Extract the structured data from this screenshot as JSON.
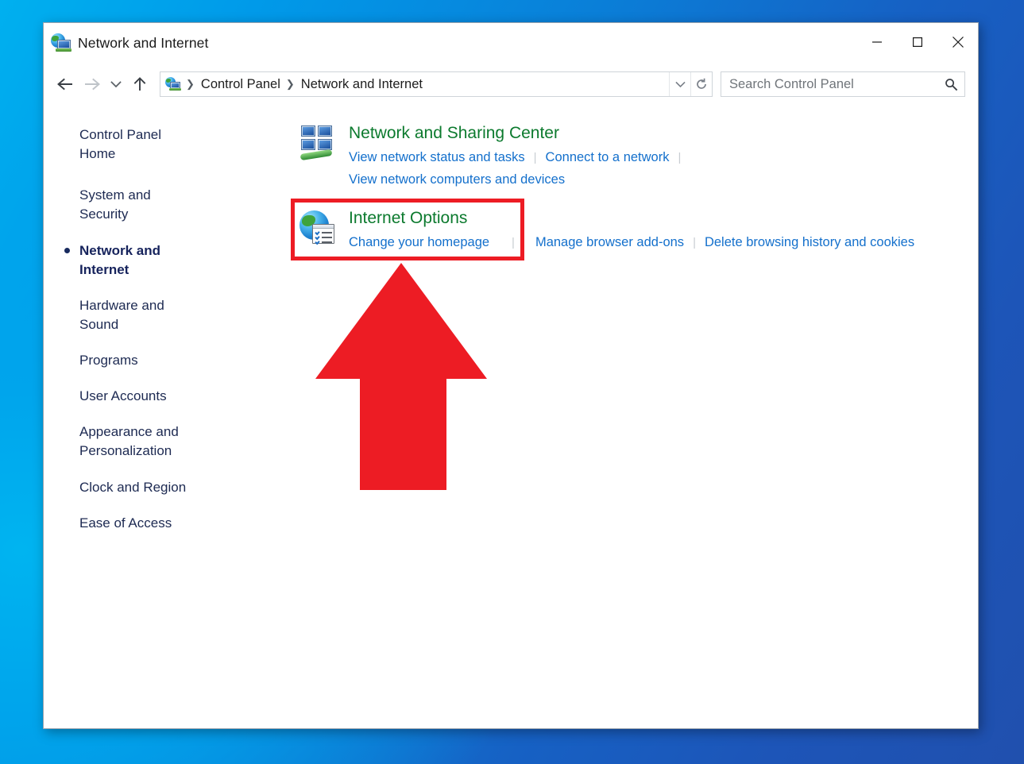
{
  "window": {
    "title": "Network and Internet",
    "icon": "network-globe-icon",
    "controls": {
      "minimize": "minimize-button",
      "maximize": "maximize-button",
      "close": "close-button"
    }
  },
  "toolbar": {
    "back": "back-arrow-icon",
    "forward": "forward-arrow-icon",
    "recent": "recent-locations-chevron-icon",
    "up": "up-arrow-icon",
    "address_icon": "network-globe-icon",
    "breadcrumbs": [
      "Control Panel",
      "Network and Internet"
    ],
    "breadcrumb_separator": "❯",
    "dropdown": "chevron-down-icon",
    "refresh": "refresh-icon"
  },
  "search": {
    "placeholder": "Search Control Panel",
    "value": "",
    "icon": "search-icon"
  },
  "sidebar": {
    "items": [
      {
        "label": "Control Panel Home",
        "current": false,
        "gap": true
      },
      {
        "label": "System and Security",
        "current": false,
        "gap": false
      },
      {
        "label": "Network and Internet",
        "current": true,
        "gap": false
      },
      {
        "label": "Hardware and Sound",
        "current": false,
        "gap": false
      },
      {
        "label": "Programs",
        "current": false,
        "gap": false
      },
      {
        "label": "User Accounts",
        "current": false,
        "gap": false
      },
      {
        "label": "Appearance and Personalization",
        "current": false,
        "gap": false
      },
      {
        "label": "Clock and Region",
        "current": false,
        "gap": false
      },
      {
        "label": "Ease of Access",
        "current": false,
        "gap": false
      }
    ]
  },
  "categories": [
    {
      "icon": "network-monitors-icon",
      "title": "Network and Sharing Center",
      "links_row1": [
        "View network status and tasks",
        "Connect to a network"
      ],
      "links_row1_trailing_separator": true,
      "links_row2": [
        "View network computers and devices"
      ]
    },
    {
      "icon": "internet-options-globe-icon",
      "title": "Internet Options",
      "links_row1": [
        "Change your homepage",
        "Manage browser add-ons",
        "Delete browsing history and cookies"
      ],
      "links_row1_trailing_separator": false,
      "links_row2": []
    }
  ],
  "annotations": {
    "highlight_box": {
      "name": "internet-options-highlight-box",
      "color": "#ed1c24",
      "target": "Internet Options"
    },
    "arrow": {
      "name": "red-up-arrow-annotation",
      "color": "#ed1c24",
      "direction": "up",
      "points_at": "Internet Options"
    }
  },
  "colors": {
    "desktop_left": "#00b0ef",
    "desktop_right": "#2050ae",
    "category_title": "#0c7a2e",
    "link": "#1470cc",
    "sidebar_text": "#1d2a52",
    "annotation_red": "#ed1c24"
  }
}
